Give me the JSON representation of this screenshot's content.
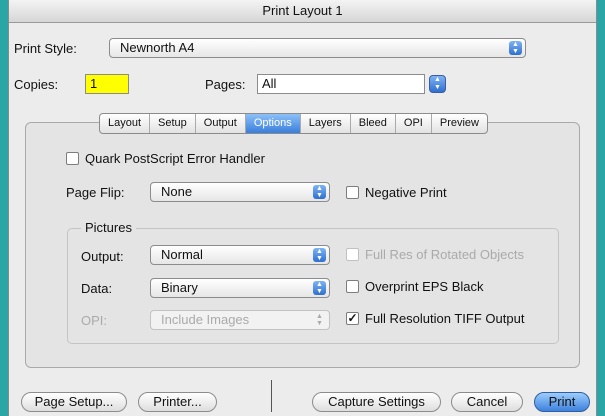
{
  "window": {
    "title": "Print Layout 1"
  },
  "print_style": {
    "label": "Print Style:",
    "value": "Newnorth A4"
  },
  "copies": {
    "label": "Copies:",
    "value": "1"
  },
  "pages": {
    "label": "Pages:",
    "value": "All"
  },
  "tabs": [
    {
      "label": "Layout"
    },
    {
      "label": "Setup"
    },
    {
      "label": "Output"
    },
    {
      "label": "Options",
      "active": true
    },
    {
      "label": "Layers"
    },
    {
      "label": "Bleed"
    },
    {
      "label": "OPI"
    },
    {
      "label": "Preview"
    }
  ],
  "options": {
    "quark_ps_handler": {
      "label": "Quark PostScript Error Handler",
      "checked": false
    },
    "page_flip": {
      "label": "Page Flip:",
      "value": "None"
    },
    "negative_print": {
      "label": "Negative Print",
      "checked": false
    },
    "pictures_group": "Pictures",
    "output": {
      "label": "Output:",
      "value": "Normal"
    },
    "data": {
      "label": "Data:",
      "value": "Binary"
    },
    "opi": {
      "label": "OPI:",
      "value": "Include Images"
    },
    "full_res_rotated": {
      "label": "Full Res of Rotated Objects",
      "checked": false
    },
    "overprint_eps": {
      "label": "Overprint EPS Black",
      "checked": false
    },
    "full_res_tiff": {
      "label": "Full Resolution TIFF Output",
      "checked": true
    }
  },
  "buttons": {
    "page_setup": "Page Setup...",
    "printer": "Printer...",
    "capture": "Capture Settings",
    "cancel": "Cancel",
    "print": "Print"
  },
  "colors": {
    "accent": "#3e82de",
    "copies_highlight": "#ffff00",
    "desktop": "#2aa6a6"
  }
}
